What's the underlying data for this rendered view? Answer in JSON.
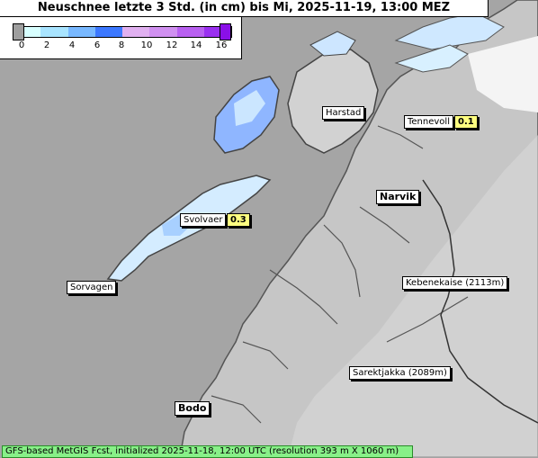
{
  "title": "Neuschnee letzte 3 Std. (in cm) bis Mi, 2025-11-19, 13:00 MEZ",
  "legend": {
    "ticks": [
      "0",
      "2",
      "4",
      "6",
      "8",
      "10",
      "12",
      "14",
      "16"
    ],
    "colors": [
      "#d8ffff",
      "#a8e4ff",
      "#78b8ff",
      "#3c78ff",
      "#e0b0f0",
      "#d090f0",
      "#b860f0",
      "#9a30f0"
    ]
  },
  "places": {
    "harstad": "Harstad",
    "tennevoll": "Tennevoll",
    "narvik": "Narvik",
    "svolvaer": "Svolvaer",
    "sorvagen": "Sorvagen",
    "kebnekaise": "Kebenekaise (2113m)",
    "sarektjakka": "Sarektjakka (2089m)",
    "bodo": "Bodo"
  },
  "values": {
    "tennevoll": "0.1",
    "svolvaer": "0.3"
  },
  "footer": "GFS-based MetGIS Fcst, initialized 2025-11-18, 12:00 UTC  (resolution 393 m X 1060 m)"
}
